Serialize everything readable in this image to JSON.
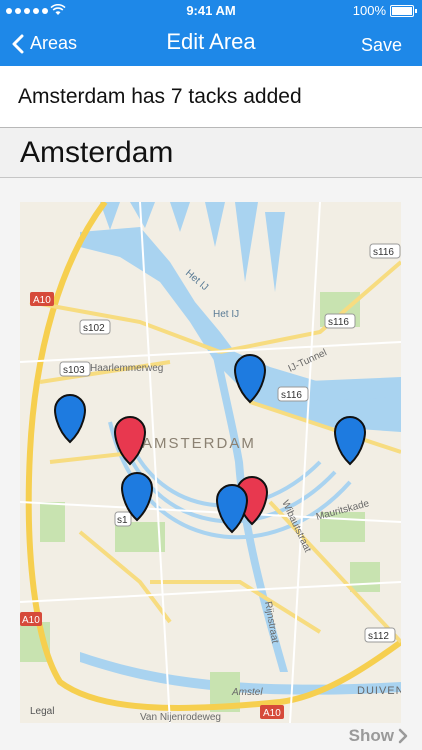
{
  "status_bar": {
    "time": "9:41 AM",
    "battery": "100%"
  },
  "nav": {
    "back_label": "Areas",
    "title": "Edit Area",
    "save_label": "Save"
  },
  "info": {
    "text": "Amsterdam has 7 tacks added"
  },
  "area_name": {
    "value": "Amsterdam"
  },
  "map": {
    "city_label": "AMSTERDAM",
    "road_labels": [
      "A10",
      "A10",
      "A10",
      "s102",
      "s103",
      "s116",
      "s116",
      "s116",
      "s112",
      "s1"
    ],
    "place_labels": [
      "Het IJ",
      "Het IJ",
      "Haarlemmerweg",
      "IJ-Tunnel",
      "Mauritskade",
      "Wibautstraat",
      "Rijnstraat",
      "Amstel",
      "DUIVEN",
      "Legal",
      "Van Nijenrodeweg"
    ],
    "pin_colors": {
      "blue": "#1e7be0",
      "red": "#e8384f"
    }
  },
  "footer": {
    "show_label": "Show"
  }
}
